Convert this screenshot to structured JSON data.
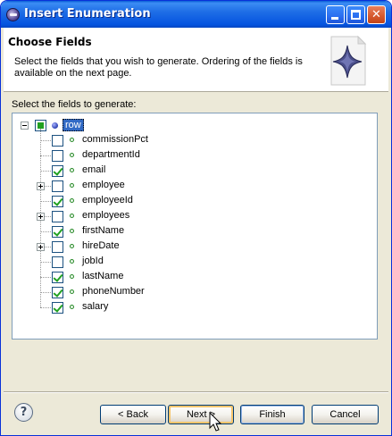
{
  "window": {
    "title": "Insert Enumeration",
    "minimize_icon": "minimize-icon",
    "maximize_icon": "maximize-icon",
    "close_icon": "close-icon",
    "close_glyph": "✕"
  },
  "banner": {
    "title": "Choose Fields",
    "description": "Select the fields that you wish to generate.   Ordering of the fields is available on the next page."
  },
  "tree": {
    "label": "Select the fields to generate:",
    "root": {
      "label": "row",
      "state": "partial",
      "expanded": true,
      "selected": true
    },
    "items": [
      {
        "label": "commissionPct",
        "checked": false,
        "expandable": false
      },
      {
        "label": "departmentId",
        "checked": false,
        "expandable": false
      },
      {
        "label": "email",
        "checked": true,
        "expandable": false
      },
      {
        "label": "employee",
        "checked": false,
        "expandable": true
      },
      {
        "label": "employeeId",
        "checked": true,
        "expandable": false
      },
      {
        "label": "employees",
        "checked": false,
        "expandable": true
      },
      {
        "label": "firstName",
        "checked": true,
        "expandable": false
      },
      {
        "label": "hireDate",
        "checked": false,
        "expandable": true
      },
      {
        "label": "jobId",
        "checked": false,
        "expandable": false
      },
      {
        "label": "lastName",
        "checked": true,
        "expandable": false
      },
      {
        "label": "phoneNumber",
        "checked": true,
        "expandable": false
      },
      {
        "label": "salary",
        "checked": true,
        "expandable": false
      }
    ]
  },
  "buttons": {
    "help": "?",
    "back": "< Back",
    "next": "Next >",
    "finish": "Finish",
    "cancel": "Cancel"
  }
}
